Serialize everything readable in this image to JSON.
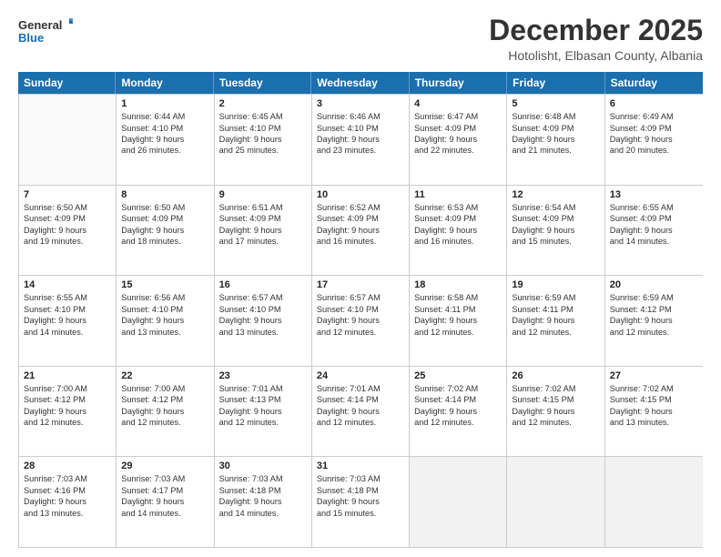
{
  "logo": {
    "line1": "General",
    "line2": "Blue"
  },
  "header": {
    "month": "December 2025",
    "location": "Hotolisht, Elbasan County, Albania"
  },
  "days": [
    "Sunday",
    "Monday",
    "Tuesday",
    "Wednesday",
    "Thursday",
    "Friday",
    "Saturday"
  ],
  "rows": [
    [
      {
        "num": "",
        "lines": [],
        "empty": true
      },
      {
        "num": "1",
        "lines": [
          "Sunrise: 6:44 AM",
          "Sunset: 4:10 PM",
          "Daylight: 9 hours",
          "and 26 minutes."
        ]
      },
      {
        "num": "2",
        "lines": [
          "Sunrise: 6:45 AM",
          "Sunset: 4:10 PM",
          "Daylight: 9 hours",
          "and 25 minutes."
        ]
      },
      {
        "num": "3",
        "lines": [
          "Sunrise: 6:46 AM",
          "Sunset: 4:10 PM",
          "Daylight: 9 hours",
          "and 23 minutes."
        ]
      },
      {
        "num": "4",
        "lines": [
          "Sunrise: 6:47 AM",
          "Sunset: 4:09 PM",
          "Daylight: 9 hours",
          "and 22 minutes."
        ]
      },
      {
        "num": "5",
        "lines": [
          "Sunrise: 6:48 AM",
          "Sunset: 4:09 PM",
          "Daylight: 9 hours",
          "and 21 minutes."
        ]
      },
      {
        "num": "6",
        "lines": [
          "Sunrise: 6:49 AM",
          "Sunset: 4:09 PM",
          "Daylight: 9 hours",
          "and 20 minutes."
        ]
      }
    ],
    [
      {
        "num": "7",
        "lines": [
          "Sunrise: 6:50 AM",
          "Sunset: 4:09 PM",
          "Daylight: 9 hours",
          "and 19 minutes."
        ]
      },
      {
        "num": "8",
        "lines": [
          "Sunrise: 6:50 AM",
          "Sunset: 4:09 PM",
          "Daylight: 9 hours",
          "and 18 minutes."
        ]
      },
      {
        "num": "9",
        "lines": [
          "Sunrise: 6:51 AM",
          "Sunset: 4:09 PM",
          "Daylight: 9 hours",
          "and 17 minutes."
        ]
      },
      {
        "num": "10",
        "lines": [
          "Sunrise: 6:52 AM",
          "Sunset: 4:09 PM",
          "Daylight: 9 hours",
          "and 16 minutes."
        ]
      },
      {
        "num": "11",
        "lines": [
          "Sunrise: 6:53 AM",
          "Sunset: 4:09 PM",
          "Daylight: 9 hours",
          "and 16 minutes."
        ]
      },
      {
        "num": "12",
        "lines": [
          "Sunrise: 6:54 AM",
          "Sunset: 4:09 PM",
          "Daylight: 9 hours",
          "and 15 minutes."
        ]
      },
      {
        "num": "13",
        "lines": [
          "Sunrise: 6:55 AM",
          "Sunset: 4:09 PM",
          "Daylight: 9 hours",
          "and 14 minutes."
        ]
      }
    ],
    [
      {
        "num": "14",
        "lines": [
          "Sunrise: 6:55 AM",
          "Sunset: 4:10 PM",
          "Daylight: 9 hours",
          "and 14 minutes."
        ]
      },
      {
        "num": "15",
        "lines": [
          "Sunrise: 6:56 AM",
          "Sunset: 4:10 PM",
          "Daylight: 9 hours",
          "and 13 minutes."
        ]
      },
      {
        "num": "16",
        "lines": [
          "Sunrise: 6:57 AM",
          "Sunset: 4:10 PM",
          "Daylight: 9 hours",
          "and 13 minutes."
        ]
      },
      {
        "num": "17",
        "lines": [
          "Sunrise: 6:57 AM",
          "Sunset: 4:10 PM",
          "Daylight: 9 hours",
          "and 12 minutes."
        ]
      },
      {
        "num": "18",
        "lines": [
          "Sunrise: 6:58 AM",
          "Sunset: 4:11 PM",
          "Daylight: 9 hours",
          "and 12 minutes."
        ]
      },
      {
        "num": "19",
        "lines": [
          "Sunrise: 6:59 AM",
          "Sunset: 4:11 PM",
          "Daylight: 9 hours",
          "and 12 minutes."
        ]
      },
      {
        "num": "20",
        "lines": [
          "Sunrise: 6:59 AM",
          "Sunset: 4:12 PM",
          "Daylight: 9 hours",
          "and 12 minutes."
        ]
      }
    ],
    [
      {
        "num": "21",
        "lines": [
          "Sunrise: 7:00 AM",
          "Sunset: 4:12 PM",
          "Daylight: 9 hours",
          "and 12 minutes."
        ]
      },
      {
        "num": "22",
        "lines": [
          "Sunrise: 7:00 AM",
          "Sunset: 4:12 PM",
          "Daylight: 9 hours",
          "and 12 minutes."
        ]
      },
      {
        "num": "23",
        "lines": [
          "Sunrise: 7:01 AM",
          "Sunset: 4:13 PM",
          "Daylight: 9 hours",
          "and 12 minutes."
        ]
      },
      {
        "num": "24",
        "lines": [
          "Sunrise: 7:01 AM",
          "Sunset: 4:14 PM",
          "Daylight: 9 hours",
          "and 12 minutes."
        ]
      },
      {
        "num": "25",
        "lines": [
          "Sunrise: 7:02 AM",
          "Sunset: 4:14 PM",
          "Daylight: 9 hours",
          "and 12 minutes."
        ]
      },
      {
        "num": "26",
        "lines": [
          "Sunrise: 7:02 AM",
          "Sunset: 4:15 PM",
          "Daylight: 9 hours",
          "and 12 minutes."
        ]
      },
      {
        "num": "27",
        "lines": [
          "Sunrise: 7:02 AM",
          "Sunset: 4:15 PM",
          "Daylight: 9 hours",
          "and 13 minutes."
        ]
      }
    ],
    [
      {
        "num": "28",
        "lines": [
          "Sunrise: 7:03 AM",
          "Sunset: 4:16 PM",
          "Daylight: 9 hours",
          "and 13 minutes."
        ]
      },
      {
        "num": "29",
        "lines": [
          "Sunrise: 7:03 AM",
          "Sunset: 4:17 PM",
          "Daylight: 9 hours",
          "and 14 minutes."
        ]
      },
      {
        "num": "30",
        "lines": [
          "Sunrise: 7:03 AM",
          "Sunset: 4:18 PM",
          "Daylight: 9 hours",
          "and 14 minutes."
        ]
      },
      {
        "num": "31",
        "lines": [
          "Sunrise: 7:03 AM",
          "Sunset: 4:18 PM",
          "Daylight: 9 hours",
          "and 15 minutes."
        ]
      },
      {
        "num": "",
        "lines": [],
        "empty": true
      },
      {
        "num": "",
        "lines": [],
        "empty": true
      },
      {
        "num": "",
        "lines": [],
        "empty": true
      }
    ]
  ]
}
